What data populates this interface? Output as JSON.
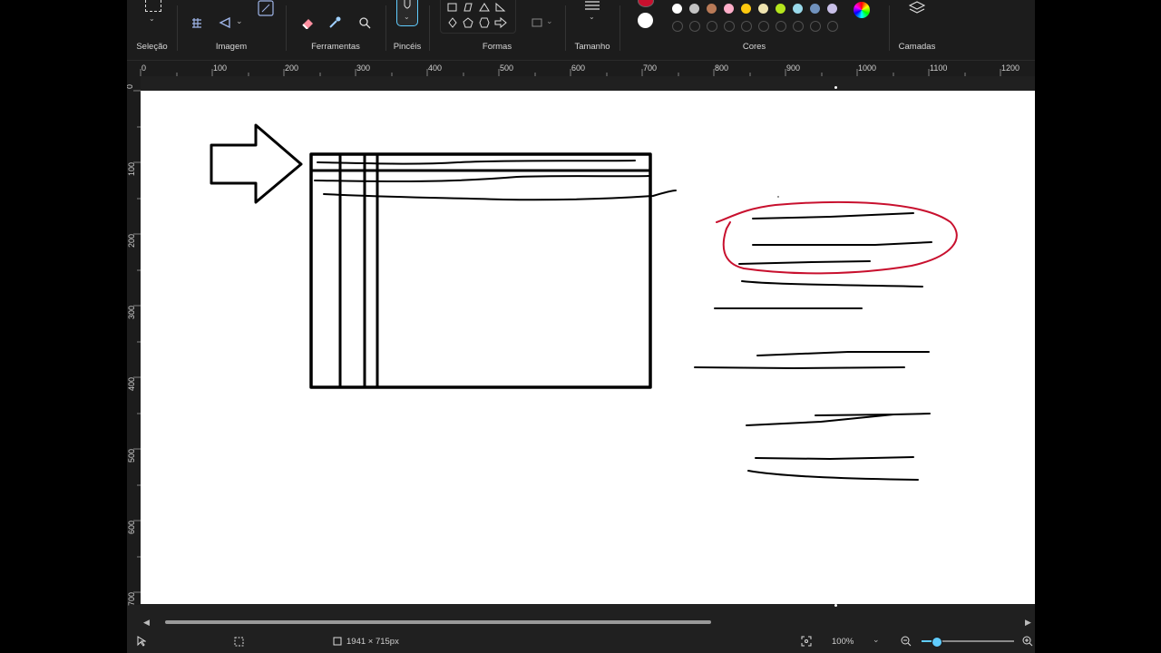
{
  "ribbon": {
    "groups": [
      {
        "id": "selecao",
        "label": "Seleção"
      },
      {
        "id": "imagem",
        "label": "Imagem"
      },
      {
        "id": "ferramentas",
        "label": "Ferramentas"
      },
      {
        "id": "pinceis",
        "label": "Pincéis"
      },
      {
        "id": "formas",
        "label": "Formas"
      },
      {
        "id": "tamanho",
        "label": "Tamanho"
      },
      {
        "id": "cores",
        "label": "Cores"
      },
      {
        "id": "camadas",
        "label": "Camadas"
      }
    ],
    "colors": {
      "primary": "#c8102e",
      "secondary": "#ffffff",
      "palette": [
        "#ffffff",
        "#c3c3c3",
        "#b97a57",
        "#ffaec9",
        "#ffc90e",
        "#efe4b0",
        "#b5e61d",
        "#99d9ea",
        "#7092be",
        "#c8bfe7"
      ],
      "accent": "#60cdff"
    }
  },
  "rulers": {
    "horizontal": [
      "0",
      "100",
      "200",
      "300",
      "400",
      "500",
      "600",
      "700",
      "800",
      "900",
      "1000",
      "1100",
      "1200"
    ],
    "vertical": [
      "0",
      "100",
      "200",
      "300",
      "400",
      "500",
      "600",
      "700"
    ]
  },
  "status": {
    "canvas_size": "1941 × 715px",
    "zoom": "100%"
  },
  "drawing": {
    "stroke": "#000000",
    "highlight": "#c8102e"
  }
}
